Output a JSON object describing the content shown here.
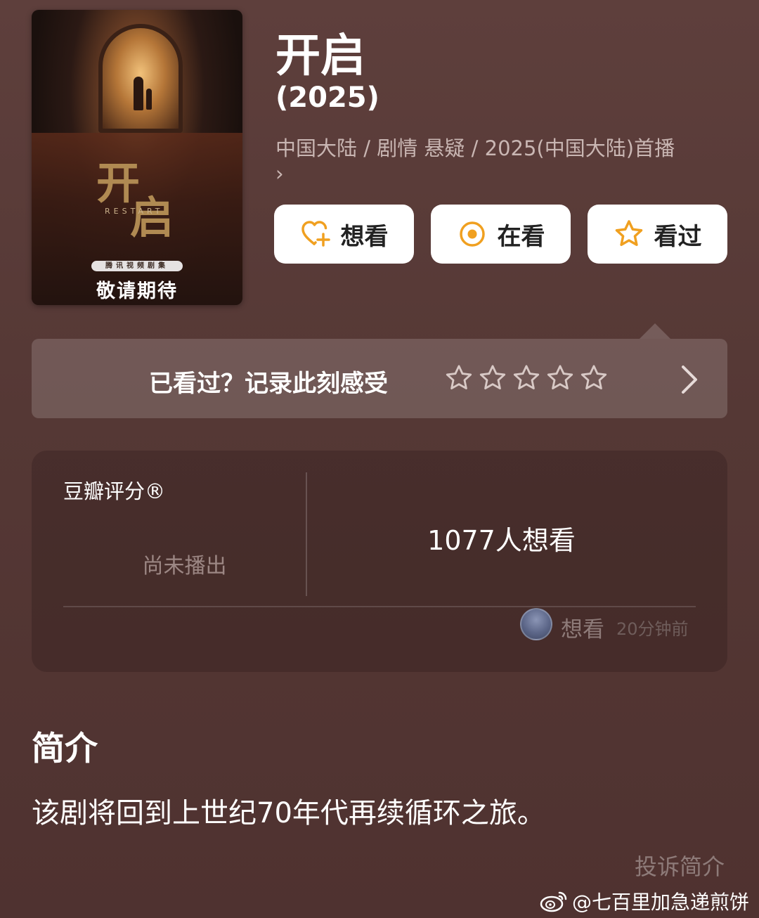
{
  "poster": {
    "title_chars": [
      "开",
      "启"
    ],
    "subtitle": "RESTART",
    "producer": "腾讯视频剧集",
    "tagline": "敬请期待"
  },
  "header": {
    "title": "开启",
    "year": "(2025)",
    "meta": "中国大陆 / 剧情 悬疑 / 2025(中国大陆)首播",
    "meta_more": "›"
  },
  "actions": {
    "want": "想看",
    "watching": "在看",
    "watched": "看过"
  },
  "rating_prompt": {
    "text": "已看过？记录此刻感受",
    "star_count": 5,
    "chevron": "chevron-right-icon"
  },
  "rating_card": {
    "label": "豆瓣评分®",
    "status": "尚未播出",
    "want_count": "1077人想看",
    "activity": {
      "action": "想看",
      "time": "20分钟前"
    }
  },
  "synopsis": {
    "title": "简介",
    "text": "该剧将回到上世纪70年代再续循环之旅。",
    "report": "投诉简介"
  },
  "watermark": {
    "text": "@七百里加急递煎饼",
    "icon": "weibo-icon"
  },
  "colors": {
    "background": "#583a37",
    "accent_orange": "#f0a020",
    "card_bg": "#472b2a",
    "muted_text": "#9c8784"
  }
}
